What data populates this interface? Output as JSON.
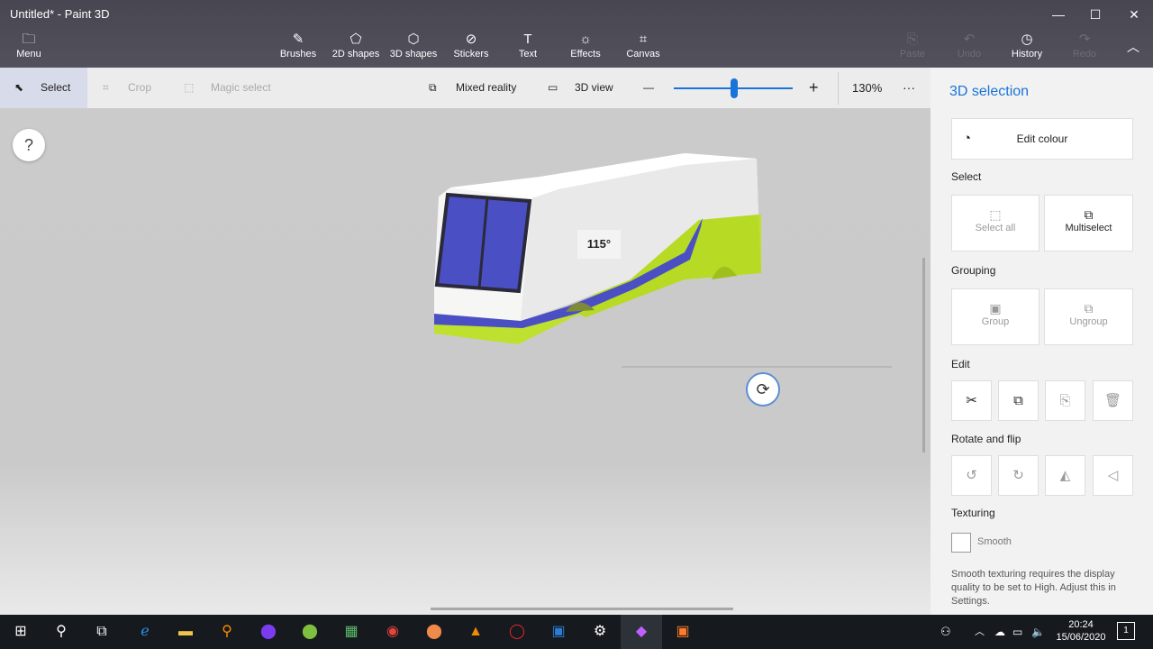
{
  "window": {
    "title": "Untitled* - Paint 3D",
    "minimize": "—",
    "maximize": "☐",
    "close": "✕"
  },
  "ribbon": {
    "menu": "Menu",
    "tools": [
      {
        "label": "Brushes",
        "icon": "✎"
      },
      {
        "label": "2D shapes",
        "icon": "⬠"
      },
      {
        "label": "3D shapes",
        "icon": "⬡"
      },
      {
        "label": "Stickers",
        "icon": "⊘"
      },
      {
        "label": "Text",
        "icon": "T"
      },
      {
        "label": "Effects",
        "icon": "☼"
      },
      {
        "label": "Canvas",
        "icon": "⌗"
      }
    ],
    "paste": "Paste",
    "undo": "Undo",
    "history": "History",
    "redo": "Redo"
  },
  "toolbar": {
    "select": "Select",
    "crop": "Crop",
    "magic_select": "Magic select",
    "mixed_reality": "Mixed reality",
    "view_3d": "3D view",
    "zoom_minus": "—",
    "zoom_plus": "+",
    "zoom": "130%",
    "more": "···",
    "zoom_fraction": 0.51
  },
  "canvas": {
    "help": "?",
    "angle": "115°"
  },
  "panel": {
    "title": "3D selection",
    "edit_colour": "Edit colour",
    "select_label": "Select",
    "select_all": "Select all",
    "multiselect": "Multiselect",
    "grouping_label": "Grouping",
    "group": "Group",
    "ungroup": "Ungroup",
    "edit_label": "Edit",
    "rotate_label": "Rotate and flip",
    "texturing_label": "Texturing",
    "smooth": "Smooth",
    "smooth_note": "Smooth texturing requires the display quality to be set to High. Adjust this in Settings."
  },
  "taskbar": {
    "time": "20:24",
    "date": "15/06/2020",
    "notifications": "1"
  },
  "colors": {
    "ribbon": "#4c4b56",
    "accent": "#1a73d9",
    "bus_blue": "#4b4fc4",
    "bus_green": "#bde12e"
  }
}
